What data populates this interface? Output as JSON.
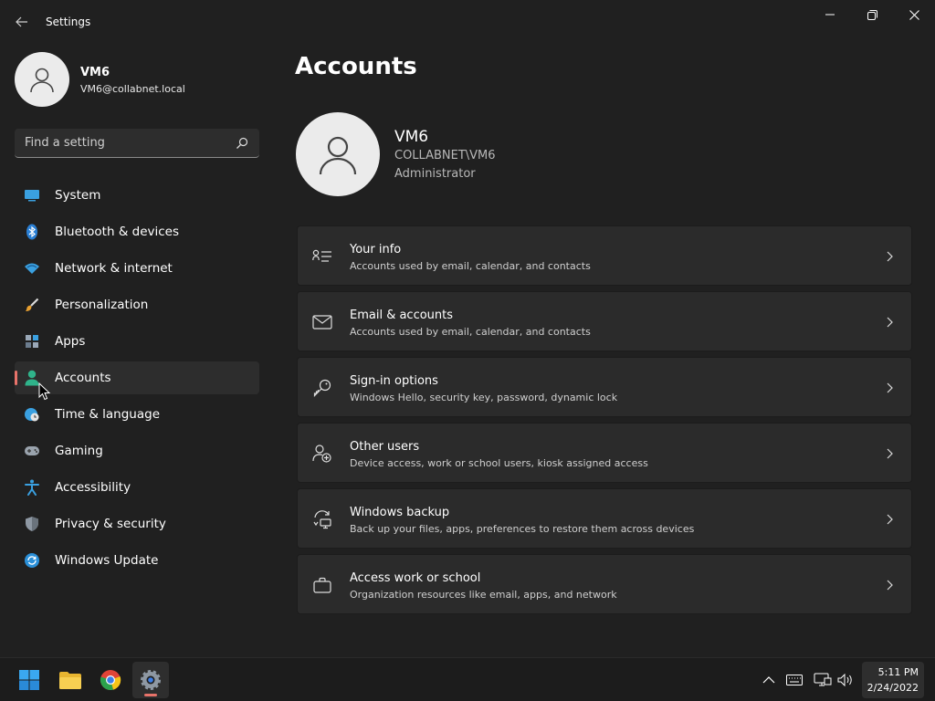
{
  "window": {
    "app_title": "Settings",
    "back_icon": "back-arrow-icon",
    "controls": [
      "minimize-icon",
      "maximize-icon",
      "close-icon"
    ]
  },
  "user": {
    "name": "VM6",
    "email": "VM6@collabnet.local"
  },
  "search": {
    "placeholder": "Find a setting",
    "value": ""
  },
  "nav": {
    "items": [
      {
        "label": "System",
        "icon": "system-display-icon"
      },
      {
        "label": "Bluetooth & devices",
        "icon": "bluetooth-icon"
      },
      {
        "label": "Network & internet",
        "icon": "wifi-icon"
      },
      {
        "label": "Personalization",
        "icon": "paintbrush-icon"
      },
      {
        "label": "Apps",
        "icon": "apps-icon"
      },
      {
        "label": "Accounts",
        "icon": "person-icon",
        "active": true
      },
      {
        "label": "Time & language",
        "icon": "globe-clock-icon"
      },
      {
        "label": "Gaming",
        "icon": "gamepad-icon"
      },
      {
        "label": "Accessibility",
        "icon": "accessibility-icon"
      },
      {
        "label": "Privacy & security",
        "icon": "shield-icon"
      },
      {
        "label": "Windows Update",
        "icon": "update-icon"
      }
    ]
  },
  "main": {
    "title": "Accounts",
    "profile": {
      "name": "VM6",
      "domain": "COLLABNET\\VM6",
      "role": "Administrator"
    },
    "cards": [
      {
        "title": "Your info",
        "subtitle": "Accounts used by email, calendar, and contacts",
        "icon": "person-card-icon"
      },
      {
        "title": "Email & accounts",
        "subtitle": "Accounts used by email, calendar, and contacts",
        "icon": "mail-icon"
      },
      {
        "title": "Sign-in options",
        "subtitle": "Windows Hello, security key, password, dynamic lock",
        "icon": "key-icon"
      },
      {
        "title": "Other users",
        "subtitle": "Device access, work or school users, kiosk assigned access",
        "icon": "person-add-icon"
      },
      {
        "title": "Windows backup",
        "subtitle": "Back up your files, apps, preferences to restore them across devices",
        "icon": "backup-icon"
      },
      {
        "title": "Access work or school",
        "subtitle": "Organization resources like email, apps, and network",
        "icon": "briefcase-icon"
      }
    ]
  },
  "taskbar": {
    "apps": [
      "windows-start-icon",
      "file-explorer-icon",
      "chrome-icon",
      "settings-icon"
    ],
    "tray": [
      "chevron-up-icon",
      "keyboard-icon",
      "network-icon",
      "volume-icon"
    ],
    "time": "5:11 PM",
    "date": "2/24/2022"
  },
  "colors": {
    "background": "#202020",
    "card": "#2b2b2b",
    "accent": "#e8736a",
    "nav_active": "#2d2d2d"
  }
}
